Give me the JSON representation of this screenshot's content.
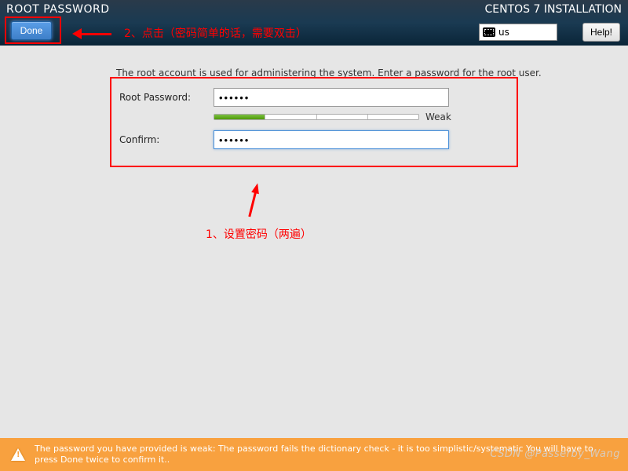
{
  "header": {
    "page_title": "ROOT PASSWORD",
    "install_title": "CENTOS 7 INSTALLATION",
    "done_label": "Done",
    "keyboard_layout": "us",
    "help_label": "Help!"
  },
  "annotations": {
    "top": "2、点击（密码简单的话，需要双击）",
    "middle": "1、设置密码（两遍）"
  },
  "form": {
    "instruction": "The root account is used for administering the system.  Enter a password for the root user.",
    "root_password_label": "Root Password:",
    "root_password_value": "••••••",
    "strength_label": "Weak",
    "confirm_label": "Confirm:",
    "confirm_value": "••••••"
  },
  "footer": {
    "warning": "The password you have provided is weak: The password fails the dictionary check - it is too simplistic/systematic You will have to press Done twice to confirm it.."
  },
  "watermark": "CSDN @Passerby_Wang",
  "colors": {
    "highlight": "#ff0000",
    "header_bg": "#1a3a52",
    "footer_bg": "#f8a13f",
    "done_btn": "#4a8fd8"
  }
}
